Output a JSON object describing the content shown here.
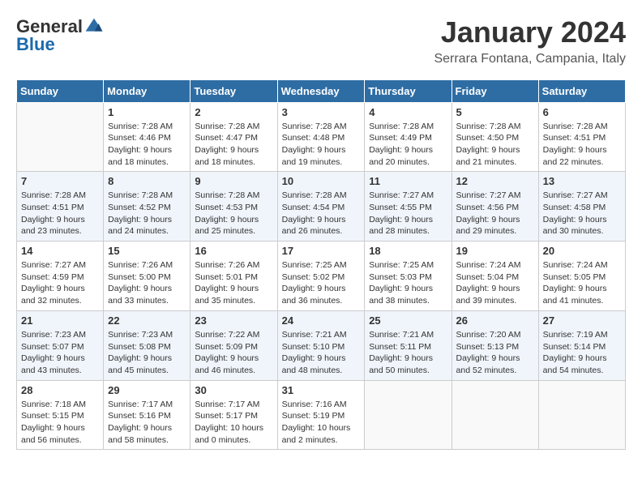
{
  "logo": {
    "general": "General",
    "blue": "Blue"
  },
  "title": "January 2024",
  "location": "Serrara Fontana, Campania, Italy",
  "weekdays": [
    "Sunday",
    "Monday",
    "Tuesday",
    "Wednesday",
    "Thursday",
    "Friday",
    "Saturday"
  ],
  "weeks": [
    [
      {
        "num": "",
        "info": ""
      },
      {
        "num": "1",
        "info": "Sunrise: 7:28 AM\nSunset: 4:46 PM\nDaylight: 9 hours\nand 18 minutes."
      },
      {
        "num": "2",
        "info": "Sunrise: 7:28 AM\nSunset: 4:47 PM\nDaylight: 9 hours\nand 18 minutes."
      },
      {
        "num": "3",
        "info": "Sunrise: 7:28 AM\nSunset: 4:48 PM\nDaylight: 9 hours\nand 19 minutes."
      },
      {
        "num": "4",
        "info": "Sunrise: 7:28 AM\nSunset: 4:49 PM\nDaylight: 9 hours\nand 20 minutes."
      },
      {
        "num": "5",
        "info": "Sunrise: 7:28 AM\nSunset: 4:50 PM\nDaylight: 9 hours\nand 21 minutes."
      },
      {
        "num": "6",
        "info": "Sunrise: 7:28 AM\nSunset: 4:51 PM\nDaylight: 9 hours\nand 22 minutes."
      }
    ],
    [
      {
        "num": "7",
        "info": "Sunrise: 7:28 AM\nSunset: 4:51 PM\nDaylight: 9 hours\nand 23 minutes."
      },
      {
        "num": "8",
        "info": "Sunrise: 7:28 AM\nSunset: 4:52 PM\nDaylight: 9 hours\nand 24 minutes."
      },
      {
        "num": "9",
        "info": "Sunrise: 7:28 AM\nSunset: 4:53 PM\nDaylight: 9 hours\nand 25 minutes."
      },
      {
        "num": "10",
        "info": "Sunrise: 7:28 AM\nSunset: 4:54 PM\nDaylight: 9 hours\nand 26 minutes."
      },
      {
        "num": "11",
        "info": "Sunrise: 7:27 AM\nSunset: 4:55 PM\nDaylight: 9 hours\nand 28 minutes."
      },
      {
        "num": "12",
        "info": "Sunrise: 7:27 AM\nSunset: 4:56 PM\nDaylight: 9 hours\nand 29 minutes."
      },
      {
        "num": "13",
        "info": "Sunrise: 7:27 AM\nSunset: 4:58 PM\nDaylight: 9 hours\nand 30 minutes."
      }
    ],
    [
      {
        "num": "14",
        "info": "Sunrise: 7:27 AM\nSunset: 4:59 PM\nDaylight: 9 hours\nand 32 minutes."
      },
      {
        "num": "15",
        "info": "Sunrise: 7:26 AM\nSunset: 5:00 PM\nDaylight: 9 hours\nand 33 minutes."
      },
      {
        "num": "16",
        "info": "Sunrise: 7:26 AM\nSunset: 5:01 PM\nDaylight: 9 hours\nand 35 minutes."
      },
      {
        "num": "17",
        "info": "Sunrise: 7:25 AM\nSunset: 5:02 PM\nDaylight: 9 hours\nand 36 minutes."
      },
      {
        "num": "18",
        "info": "Sunrise: 7:25 AM\nSunset: 5:03 PM\nDaylight: 9 hours\nand 38 minutes."
      },
      {
        "num": "19",
        "info": "Sunrise: 7:24 AM\nSunset: 5:04 PM\nDaylight: 9 hours\nand 39 minutes."
      },
      {
        "num": "20",
        "info": "Sunrise: 7:24 AM\nSunset: 5:05 PM\nDaylight: 9 hours\nand 41 minutes."
      }
    ],
    [
      {
        "num": "21",
        "info": "Sunrise: 7:23 AM\nSunset: 5:07 PM\nDaylight: 9 hours\nand 43 minutes."
      },
      {
        "num": "22",
        "info": "Sunrise: 7:23 AM\nSunset: 5:08 PM\nDaylight: 9 hours\nand 45 minutes."
      },
      {
        "num": "23",
        "info": "Sunrise: 7:22 AM\nSunset: 5:09 PM\nDaylight: 9 hours\nand 46 minutes."
      },
      {
        "num": "24",
        "info": "Sunrise: 7:21 AM\nSunset: 5:10 PM\nDaylight: 9 hours\nand 48 minutes."
      },
      {
        "num": "25",
        "info": "Sunrise: 7:21 AM\nSunset: 5:11 PM\nDaylight: 9 hours\nand 50 minutes."
      },
      {
        "num": "26",
        "info": "Sunrise: 7:20 AM\nSunset: 5:13 PM\nDaylight: 9 hours\nand 52 minutes."
      },
      {
        "num": "27",
        "info": "Sunrise: 7:19 AM\nSunset: 5:14 PM\nDaylight: 9 hours\nand 54 minutes."
      }
    ],
    [
      {
        "num": "28",
        "info": "Sunrise: 7:18 AM\nSunset: 5:15 PM\nDaylight: 9 hours\nand 56 minutes."
      },
      {
        "num": "29",
        "info": "Sunrise: 7:17 AM\nSunset: 5:16 PM\nDaylight: 9 hours\nand 58 minutes."
      },
      {
        "num": "30",
        "info": "Sunrise: 7:17 AM\nSunset: 5:17 PM\nDaylight: 10 hours\nand 0 minutes."
      },
      {
        "num": "31",
        "info": "Sunrise: 7:16 AM\nSunset: 5:19 PM\nDaylight: 10 hours\nand 2 minutes."
      },
      {
        "num": "",
        "info": ""
      },
      {
        "num": "",
        "info": ""
      },
      {
        "num": "",
        "info": ""
      }
    ]
  ]
}
